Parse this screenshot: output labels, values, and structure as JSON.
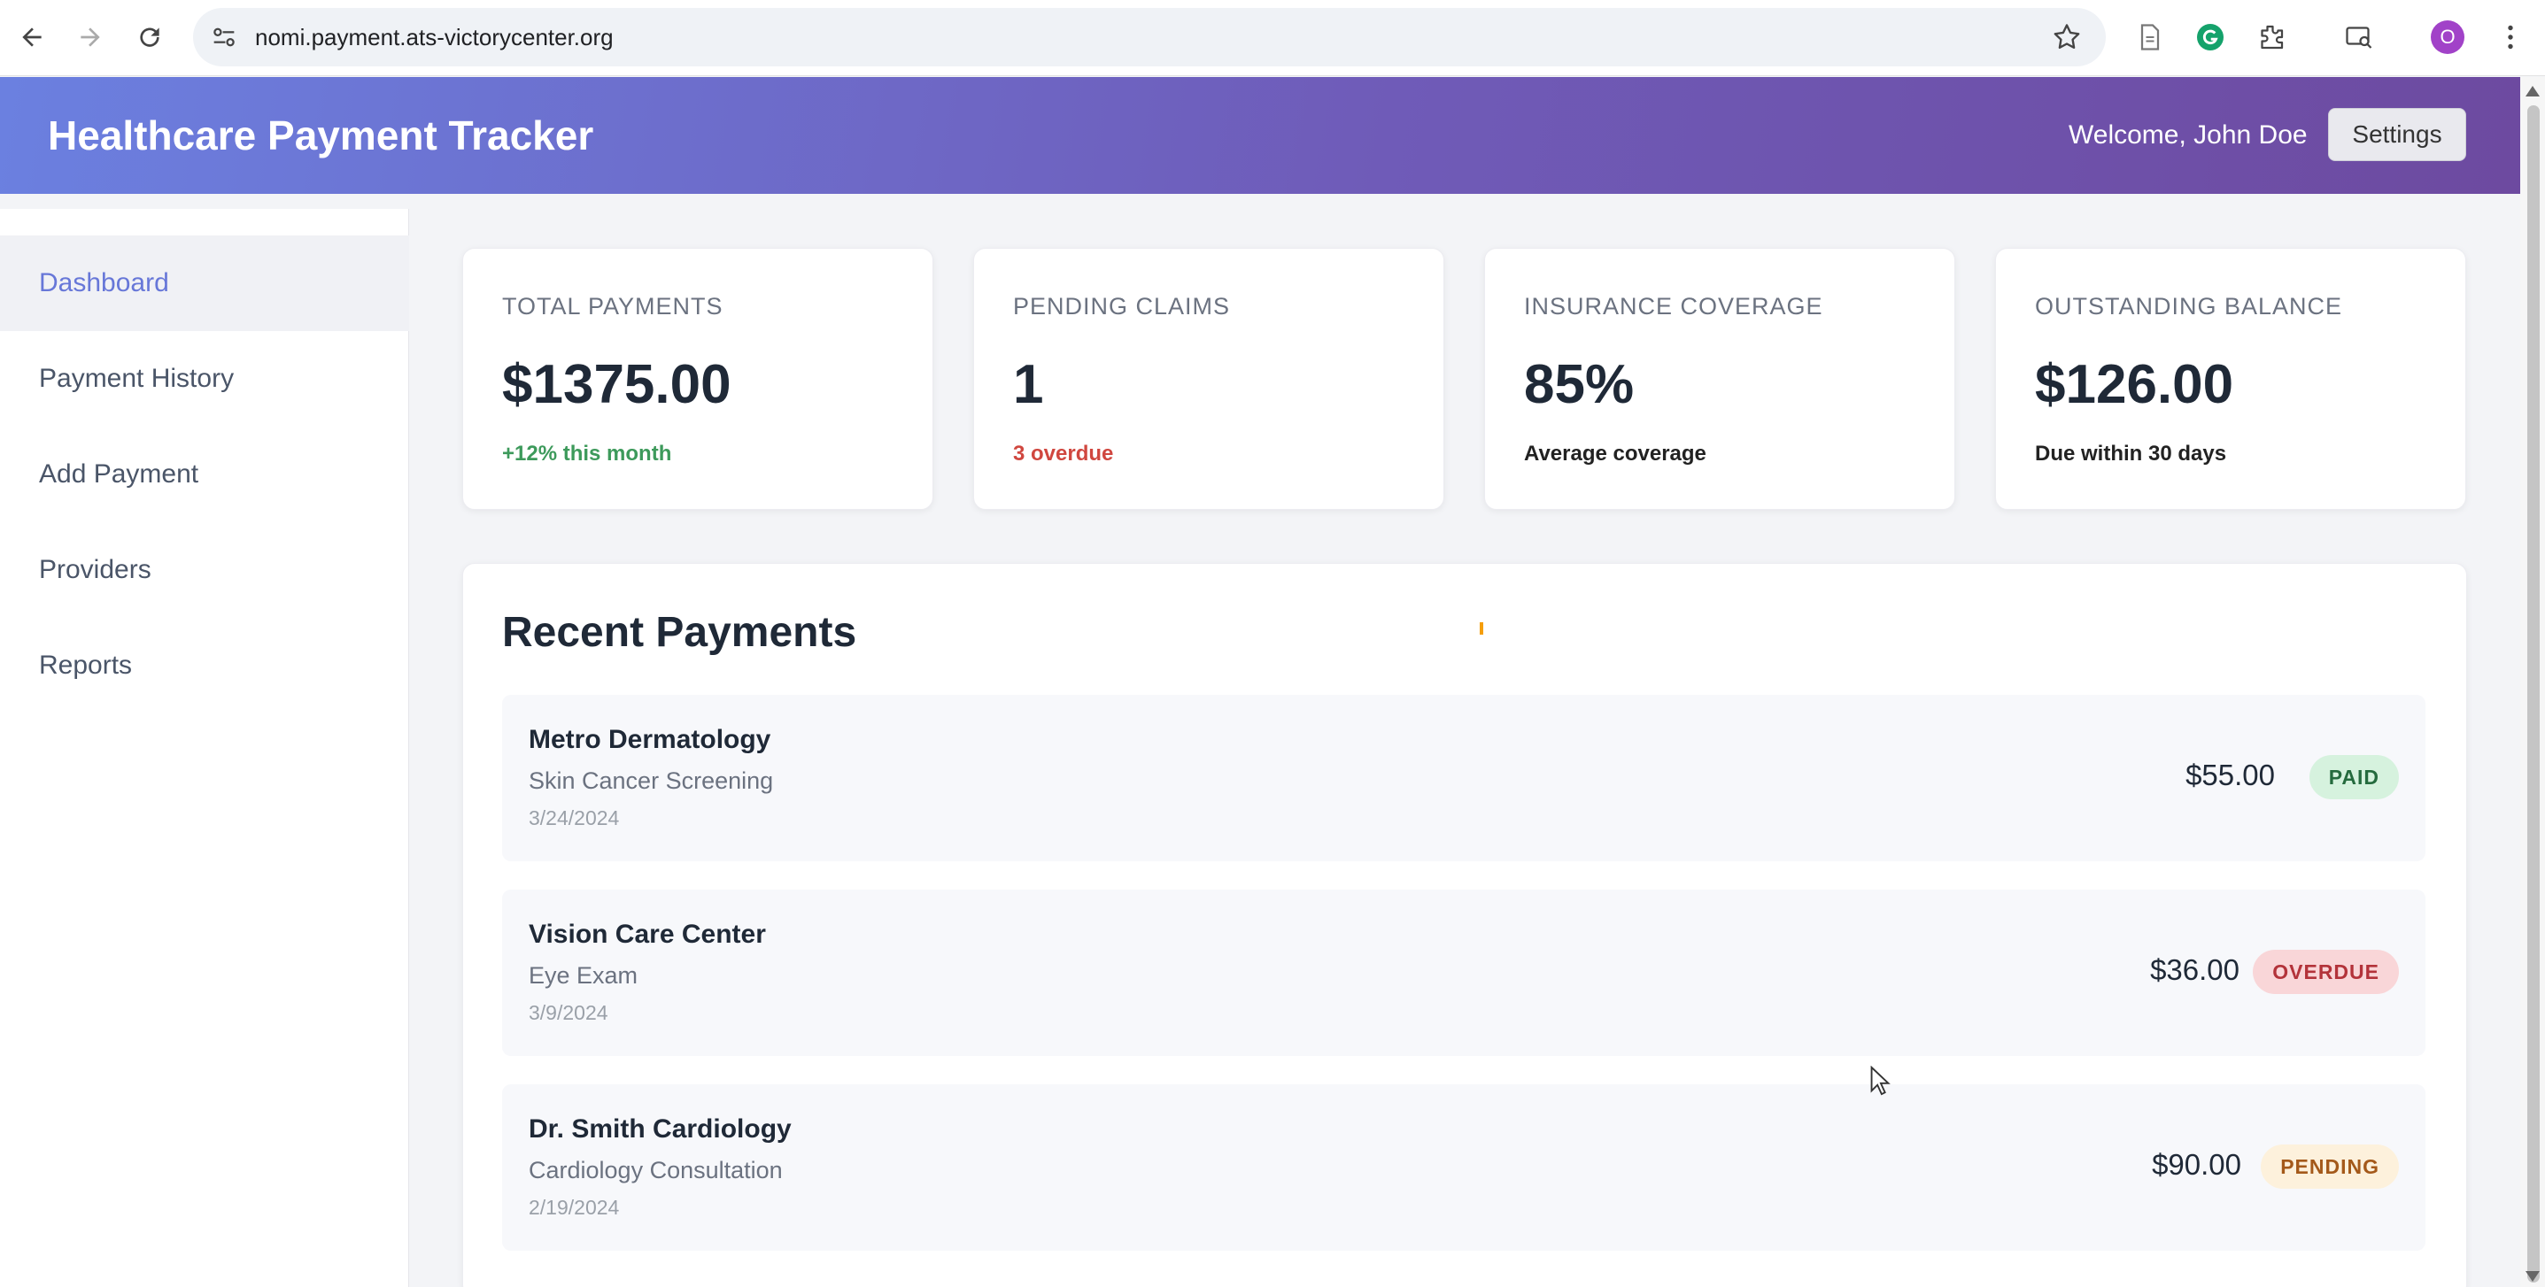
{
  "browser": {
    "url": "nomi.payment.ats-victorycenter.org",
    "profile_initial": "O",
    "icons": [
      "back-icon",
      "forward-icon",
      "reload-icon",
      "site-settings-icon",
      "star-icon",
      "document-icon",
      "grammarly-icon",
      "extensions-icon",
      "media-icon",
      "profile-avatar",
      "more-icon"
    ]
  },
  "header": {
    "title": "Healthcare Payment Tracker",
    "welcome": "Welcome, John Doe",
    "settings_label": "Settings"
  },
  "sidebar": {
    "items": [
      {
        "label": "Dashboard",
        "active": true
      },
      {
        "label": "Payment History",
        "active": false
      },
      {
        "label": "Add Payment",
        "active": false
      },
      {
        "label": "Providers",
        "active": false
      },
      {
        "label": "Reports",
        "active": false
      }
    ]
  },
  "stats": [
    {
      "label": "TOTAL PAYMENTS",
      "value": "$1375.00",
      "sub": "+12% this month",
      "sub_color": "#3d9a5b"
    },
    {
      "label": "PENDING CLAIMS",
      "value": "1",
      "sub": "3 overdue",
      "sub_color": "#d0473f"
    },
    {
      "label": "INSURANCE COVERAGE",
      "value": "85%",
      "sub": "Average coverage",
      "sub_color": "#222222"
    },
    {
      "label": "OUTSTANDING BALANCE",
      "value": "$126.00",
      "sub": "Due within 30 days",
      "sub_color": "#222222"
    }
  ],
  "recent": {
    "title": "Recent Payments",
    "payments": [
      {
        "provider": "Metro Dermatology",
        "service": "Skin Cancer Screening",
        "date": "3/24/2024",
        "amount": "$55.00",
        "status": "PAID"
      },
      {
        "provider": "Vision Care Center",
        "service": "Eye Exam",
        "date": "3/9/2024",
        "amount": "$36.00",
        "status": "OVERDUE"
      },
      {
        "provider": "Dr. Smith Cardiology",
        "service": "Cardiology Consultation",
        "date": "2/19/2024",
        "amount": "$90.00",
        "status": "PENDING"
      }
    ]
  },
  "colors": {
    "accent": "#6777d8",
    "header_gradient_start": "#6b80e0",
    "header_gradient_end": "#6d4aa0",
    "paid": "#256b3e",
    "overdue": "#b3333a",
    "pending": "#a4591a"
  }
}
